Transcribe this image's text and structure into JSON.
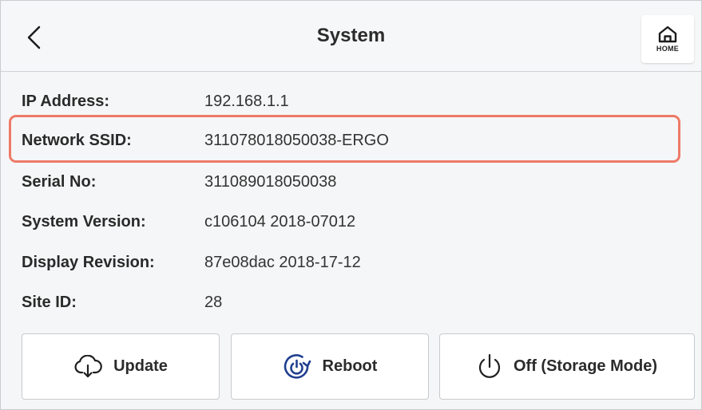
{
  "header": {
    "title": "System",
    "home_label": "HOME",
    "back_icon": "chevron-left-icon",
    "home_icon": "home-icon"
  },
  "info": [
    {
      "key": "IP Address:",
      "value": "192.168.1.1"
    },
    {
      "key": "Network SSID:",
      "value": "311078018050038-ERGO",
      "highlighted": true
    },
    {
      "key": "Serial No:",
      "value": "311089018050038"
    },
    {
      "key": "System Version:",
      "value": "c106104 2018-07012"
    },
    {
      "key": "Display Revision:",
      "value": "87e08dac 2018-17-12"
    },
    {
      "key": "Site ID:",
      "value": "28"
    }
  ],
  "buttons": {
    "update": {
      "label": "Update",
      "icon": "cloud-download-icon"
    },
    "reboot": {
      "label": "Reboot",
      "icon": "reboot-icon"
    },
    "off": {
      "label": "Off (Storage Mode)",
      "icon": "power-icon"
    }
  },
  "colors": {
    "highlight": "#ee7a68",
    "background": "#f5f6f7",
    "accent_icon": "#1f3f8f"
  }
}
